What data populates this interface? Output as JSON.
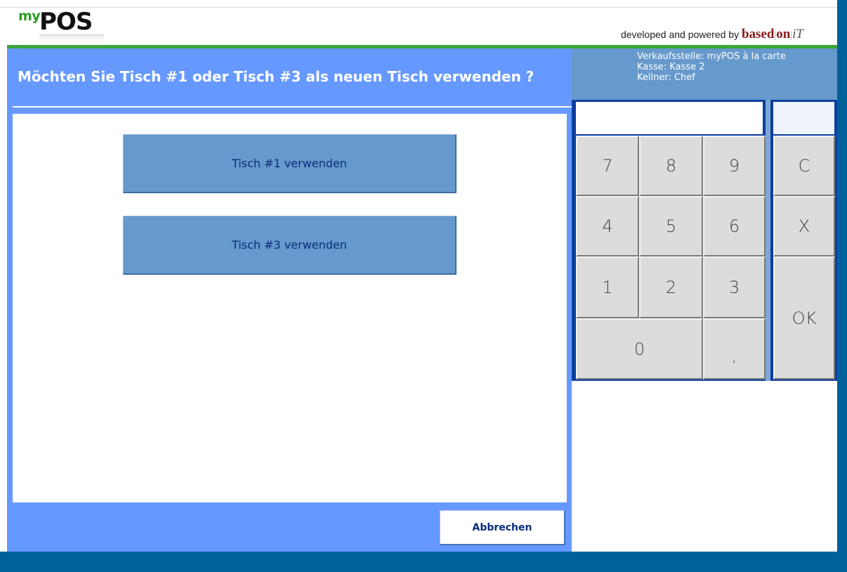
{
  "header": {
    "logo_my": "my",
    "logo_pos": "POS",
    "credit_prefix": "developed and powered by ",
    "credit_brand_based": "based",
    "credit_brand_on": "on",
    "credit_brand_it": "iT"
  },
  "dialog": {
    "question": "Möchten Sie Tisch #1 oder Tisch #3 als neuen Tisch verwenden ?",
    "choices": [
      {
        "label": "Tisch #1 verwenden"
      },
      {
        "label": "Tisch #3 verwenden"
      }
    ],
    "cancel_label": "Abbrechen"
  },
  "session": {
    "verkaufsstelle": "Verkaufsstelle: myPOS à la carte",
    "kasse": "Kasse: Kasse 2",
    "kellner": "Kellner: Chef"
  },
  "keypad": {
    "display_value": "",
    "side_value": "",
    "keys": {
      "k7": "7",
      "k8": "8",
      "k9": "9",
      "clear": "C",
      "k4": "4",
      "k5": "5",
      "k6": "6",
      "cancel": "X",
      "k1": "1",
      "k2": "2",
      "k3": "3",
      "ok": "OK",
      "k0": "0",
      "comma": ","
    }
  },
  "colors": {
    "accent_blue": "#6699ff",
    "button_blue": "#6699cc",
    "frame_dark": "#00609a",
    "brand_green": "#3da53a"
  }
}
